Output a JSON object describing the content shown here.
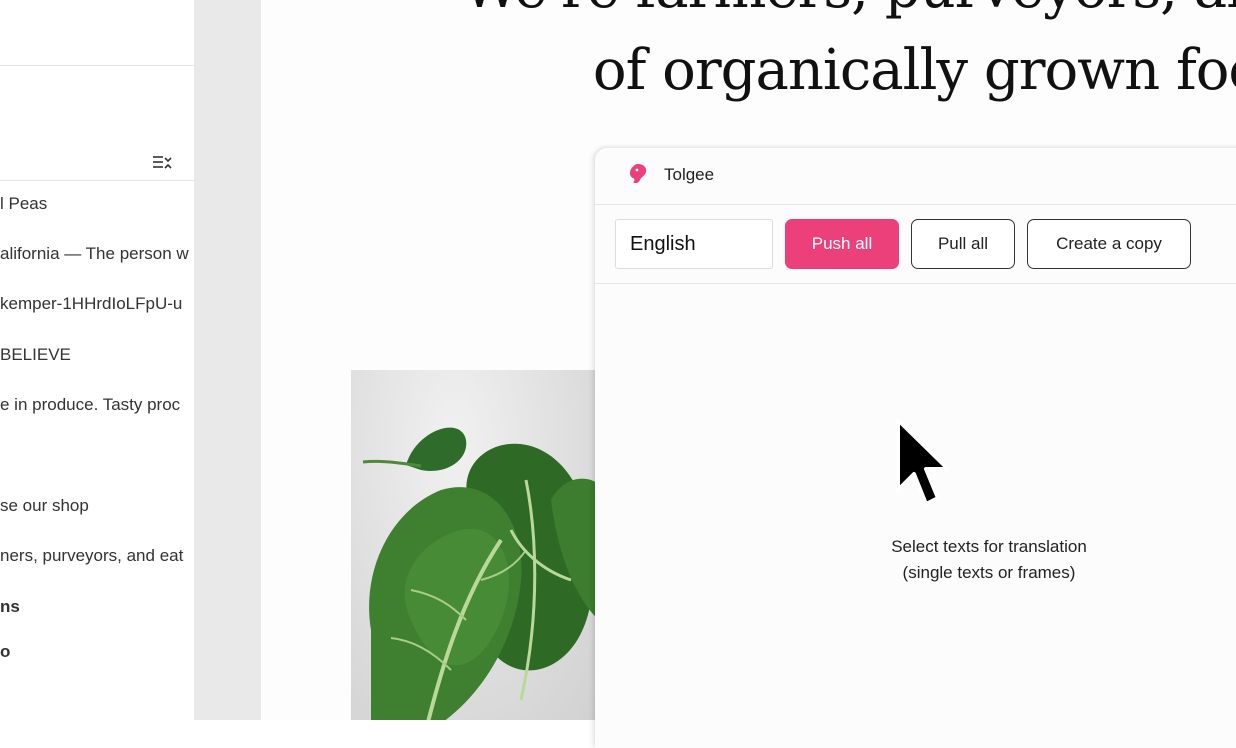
{
  "layers_panel": {
    "sort_icon": "sort-icon",
    "items": [
      {
        "label": "l Peas",
        "bold": false
      },
      {
        "label": "alifornia — The person w",
        "bold": false
      },
      {
        "label": "kemper-1HHrdIoLFpU-u",
        "bold": false
      },
      {
        "label": " BELIEVE",
        "bold": false
      },
      {
        "label": "e in produce. Tasty proc",
        "bold": false
      },
      {
        "label": "se our shop",
        "bold": false
      },
      {
        "label": "ners, purveyors, and eat",
        "bold": false
      },
      {
        "label": "ns",
        "bold": true
      },
      {
        "label": "o",
        "bold": true
      }
    ]
  },
  "canvas": {
    "hero_line_1": "We're farmers, purveyors, and",
    "hero_line_2": "of organically grown food"
  },
  "tolgee": {
    "title": "Tolgee",
    "logo_icon": "tolgee-logo-icon",
    "accent_color": "#ec407a",
    "language": "English",
    "push_all_label": "Push all",
    "pull_all_label": "Pull all",
    "create_copy_label": "Create a copy",
    "empty_line_1": "Select texts for translation",
    "empty_line_2": "(single texts or frames)"
  }
}
